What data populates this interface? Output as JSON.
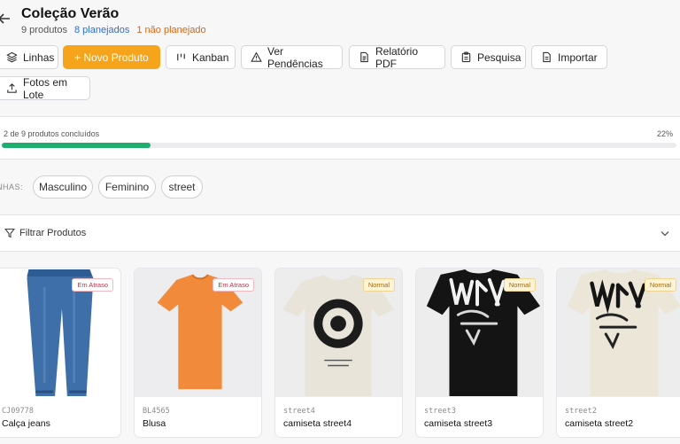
{
  "header": {
    "title": "Coleção Verão",
    "stat_total": "9 produtos",
    "stat_planned": "8 planejados",
    "stat_unplanned": "1 não planejado"
  },
  "toolbar": {
    "lines_label": "Linhas",
    "new_product_label": "+ Novo Produto",
    "kanban_label": "Kanban",
    "pending_label": "Ver Pendências",
    "pdf_label": "Relatório PDF",
    "research_label": "Pesquisa",
    "import_label": "Importar",
    "batch_photos_label": "Fotos em Lote"
  },
  "progress": {
    "label": "2 de 9 produtos concluídos",
    "percent_text": "22%",
    "fraction": 0.22
  },
  "lines": {
    "label": "NHAS:",
    "chips": [
      "Masculino",
      "Feminino",
      "street"
    ]
  },
  "filter": {
    "label": "Filtrar Produtos"
  },
  "products": [
    {
      "code": "CJ09778",
      "name": "Calça jeans",
      "status": "Em Atraso",
      "image": "jeans"
    },
    {
      "code": "BL4565",
      "name": "Blusa",
      "status": "Em Atraso",
      "image": "orange-tshirt"
    },
    {
      "code": "street4",
      "name": "camiseta street4",
      "status": "Normal",
      "image": "cream-tshirt-graphic"
    },
    {
      "code": "street3",
      "name": "camiseta street3",
      "status": "Normal",
      "image": "black-tshirt-graffiti"
    },
    {
      "code": "street2",
      "name": "camiseta street2",
      "status": "Normal",
      "image": "cream-tshirt-graffiti"
    }
  ],
  "colors": {
    "accent": "#f5a41c",
    "progress": "#1fae6f",
    "planned": "#2f6fd1",
    "unplanned": "#d4681a",
    "late_badge": "#c0304a",
    "normal_badge": "#9a6a0a"
  }
}
